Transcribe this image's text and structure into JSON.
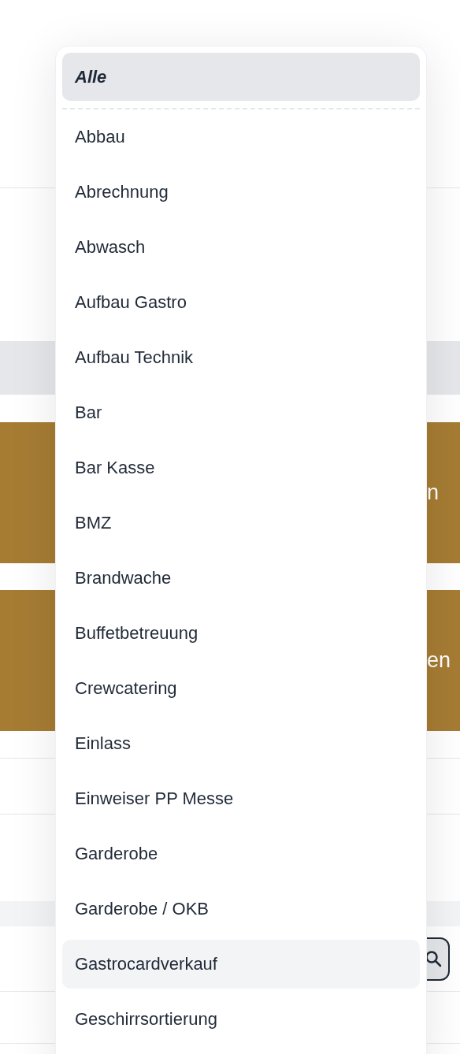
{
  "background": {
    "cards": [
      {
        "text": "n"
      },
      {
        "text": "en"
      }
    ]
  },
  "dropdown": {
    "all_option": {
      "label": "Alle",
      "selected": true
    },
    "options": [
      {
        "label": "Abbau",
        "selected": false,
        "hovered": false
      },
      {
        "label": "Abrechnung",
        "selected": false,
        "hovered": false
      },
      {
        "label": "Abwasch",
        "selected": false,
        "hovered": false
      },
      {
        "label": "Aufbau Gastro",
        "selected": false,
        "hovered": false
      },
      {
        "label": "Aufbau Technik",
        "selected": false,
        "hovered": false
      },
      {
        "label": "Bar",
        "selected": false,
        "hovered": false
      },
      {
        "label": "Bar Kasse",
        "selected": false,
        "hovered": false
      },
      {
        "label": "BMZ",
        "selected": false,
        "hovered": false
      },
      {
        "label": "Brandwache",
        "selected": false,
        "hovered": false
      },
      {
        "label": "Buffetbetreuung",
        "selected": false,
        "hovered": false
      },
      {
        "label": "Crewcatering",
        "selected": false,
        "hovered": false
      },
      {
        "label": "Einlass",
        "selected": false,
        "hovered": false
      },
      {
        "label": "Einweiser PP Messe",
        "selected": false,
        "hovered": false
      },
      {
        "label": "Garderobe",
        "selected": false,
        "hovered": false
      },
      {
        "label": "Garderobe / OKB",
        "selected": false,
        "hovered": false
      },
      {
        "label": "Gastrocardverkauf",
        "selected": false,
        "hovered": true
      },
      {
        "label": "Geschirrsortierung",
        "selected": false,
        "hovered": false
      }
    ]
  }
}
